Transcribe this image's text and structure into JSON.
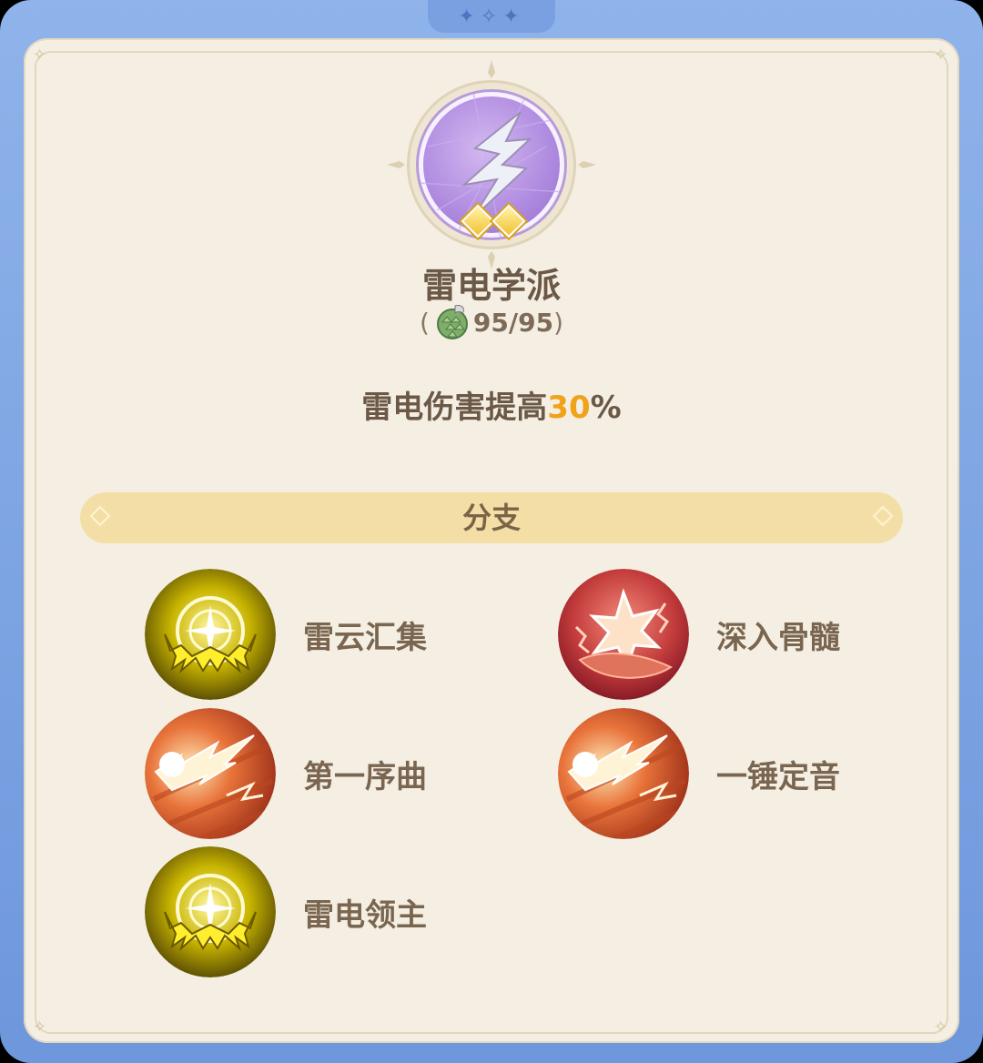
{
  "frame": {
    "ornament_icon": "sparkle-stars-icon"
  },
  "school": {
    "emblem_icon": "lightning-emblem-icon",
    "rank_diamonds": 2,
    "name": "雷电学派",
    "points_open": "(",
    "points_value": "95/95",
    "points_close": ")",
    "points_icon": "pinecone-currency-icon",
    "effect_prefix": "雷电伤害提高",
    "effect_value": "30",
    "effect_suffix": "%"
  },
  "section": {
    "title": "分支"
  },
  "branches": [
    {
      "label": "雷云汇集",
      "icon": "thunder-cloud-icon",
      "icon_style": "gold"
    },
    {
      "label": "深入骨髓",
      "icon": "deep-strike-icon",
      "icon_style": "crimson"
    },
    {
      "label": "第一序曲",
      "icon": "lightning-burst-icon",
      "icon_style": "orange"
    },
    {
      "label": "一锤定音",
      "icon": "lightning-burst-icon",
      "icon_style": "orange"
    },
    {
      "label": "雷电领主",
      "icon": "thunder-cloud-icon",
      "icon_style": "gold"
    }
  ],
  "colors": {
    "frame_blue": "#7aa0e2",
    "panel_cream": "#f4efe2",
    "text_brown": "#6b5847",
    "highlight_orange": "#f0a21b",
    "section_bar": "#f3dfa6"
  }
}
